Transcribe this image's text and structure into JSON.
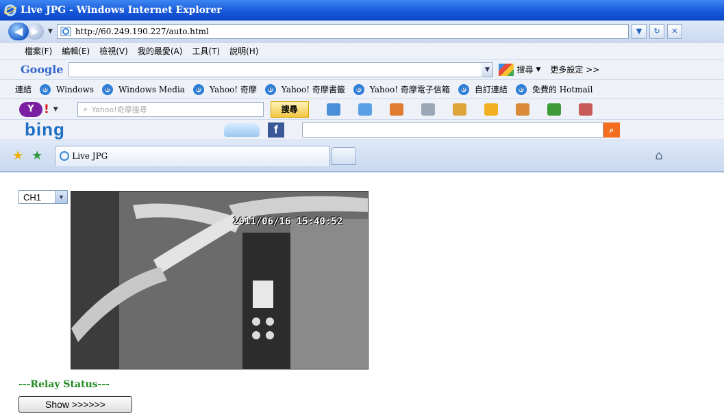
{
  "window": {
    "title": "Live JPG - Windows Internet Explorer"
  },
  "address": {
    "url": "http://60.249.190.227/auto.html",
    "refresh": "↻",
    "stop": "✕"
  },
  "menu": [
    "檔案(F)",
    "編輯(E)",
    "檢視(V)",
    "我的最愛(A)",
    "工具(T)",
    "說明(H)"
  ],
  "google": {
    "logo": "Google",
    "search_label": "搜尋",
    "more_settings": "更多設定 >>"
  },
  "links": {
    "label": "連結",
    "items": [
      "Windows",
      "Windows Media",
      "Yahoo! 奇摩",
      "Yahoo! 奇摩書籤",
      "Yahoo! 奇摩電子信箱",
      "自訂連結",
      "免費的 Hotmail"
    ]
  },
  "yahoo": {
    "logo": "Y",
    "placeholder": "Yahoo!奇摩搜尋",
    "search_button": "搜尋"
  },
  "bing": {
    "logo": "bing",
    "fb": "f"
  },
  "tabs": {
    "active": "Live JPG"
  },
  "content": {
    "channel": "CH1",
    "timestamp": "2011/06/16  15:40:52",
    "relay_status": "---Relay Status---",
    "show_button": "Show >>>>>>"
  }
}
